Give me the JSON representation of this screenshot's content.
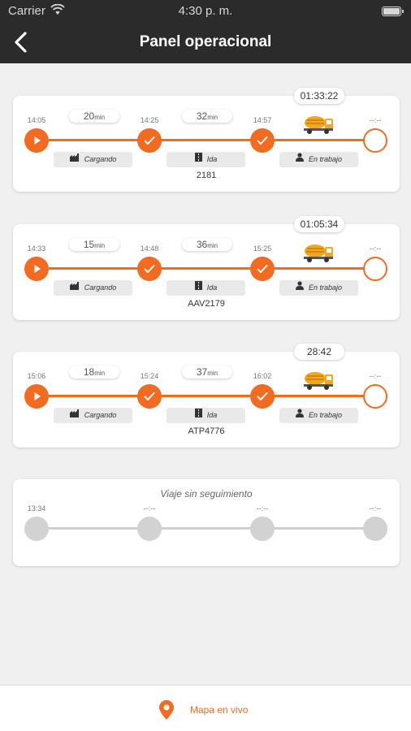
{
  "status_bar": {
    "carrier": "Carrier",
    "time": "4:30 p. m."
  },
  "nav": {
    "title": "Panel operacional"
  },
  "colors": {
    "accent": "#f26b21",
    "header_bg": "#2b2b2b",
    "background": "#f0f0f0"
  },
  "icons": {
    "back": "chevron-left-icon",
    "play": "play-icon",
    "check": "check-icon",
    "truck": "concrete-mixer-truck-icon",
    "factory": "factory-icon",
    "road": "road-icon",
    "worker": "worker-icon",
    "map_pin": "map-pin-icon"
  },
  "trips": [
    {
      "duration": "01:33:22",
      "times": [
        "14:05",
        "14:25",
        "14:57",
        "--:--"
      ],
      "segments": [
        {
          "value": "20",
          "unit": "min"
        },
        {
          "value": "32",
          "unit": "min"
        }
      ],
      "stages": [
        "Cargando",
        "Ida",
        "En trabajo"
      ],
      "plate": "2181"
    },
    {
      "duration": "01:05:34",
      "times": [
        "14:33",
        "14:48",
        "15:25",
        "--:--"
      ],
      "segments": [
        {
          "value": "15",
          "unit": "min"
        },
        {
          "value": "36",
          "unit": "min"
        }
      ],
      "stages": [
        "Cargando",
        "Ida",
        "En trabajo"
      ],
      "plate": "AAV2179"
    },
    {
      "duration": "28:42",
      "times": [
        "15:06",
        "15:24",
        "16:02",
        "--:--"
      ],
      "segments": [
        {
          "value": "18",
          "unit": "min"
        },
        {
          "value": "37",
          "unit": "min"
        }
      ],
      "stages": [
        "Cargando",
        "Ida",
        "En trabajo"
      ],
      "plate": "ATP4776"
    }
  ],
  "untracked": {
    "title": "Viaje sin seguimiento",
    "times": [
      "13:34",
      "--:--",
      "--:--",
      "--:--"
    ]
  },
  "bottom": {
    "live_map_label": "Mapa en vivo"
  }
}
